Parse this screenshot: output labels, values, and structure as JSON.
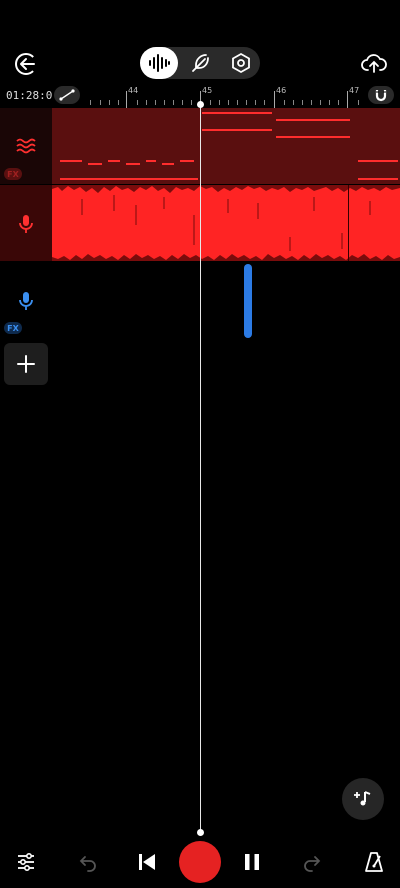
{
  "toolbar": {
    "back": "back-icon",
    "modes": [
      "waveform-icon",
      "feather-icon",
      "hexagon-settings-icon"
    ],
    "active_mode": 0,
    "upload": "cloud-upload-icon"
  },
  "timeline": {
    "time": "01:28:0",
    "bars": [
      "44",
      "45",
      "46",
      "47"
    ]
  },
  "tracks": [
    {
      "type": "instrument",
      "icon": "synth-wave-icon",
      "fx_badge": "FX",
      "color": "#ff3030"
    },
    {
      "type": "audio",
      "icon": "microphone-icon",
      "color": "#ff3030"
    },
    {
      "type": "audio",
      "icon": "microphone-icon",
      "fx_badge": "FX",
      "color": "#3b8ff0"
    }
  ],
  "transport": {
    "mixer": "sliders-icon",
    "undo": "undo-icon",
    "skip_back": "skip-back-icon",
    "record": "record-button",
    "pause": "pause-icon",
    "redo": "redo-icon",
    "metronome": "metronome-icon"
  },
  "colors": {
    "accent": "#e52222",
    "midi_bg": "#5a0f0f",
    "audio_bg": "#7a0c0c",
    "blue": "#2c7be5"
  }
}
